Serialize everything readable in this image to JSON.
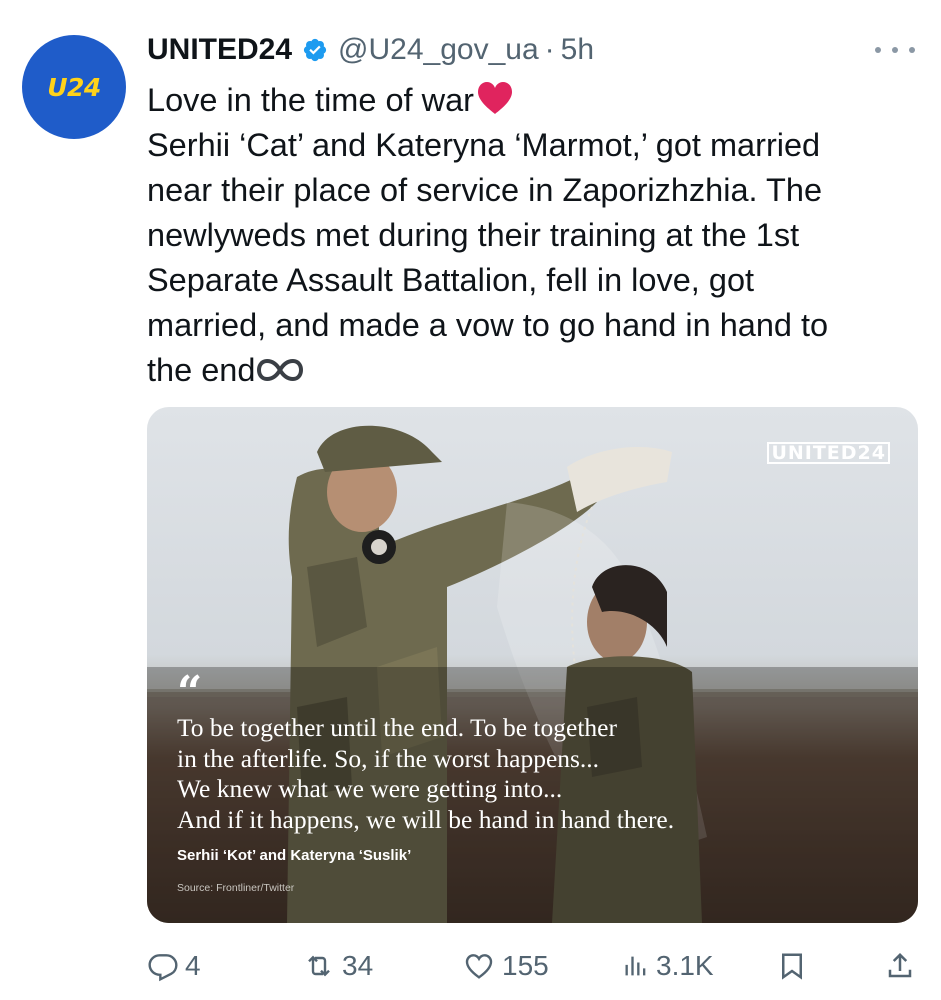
{
  "tweet": {
    "author": {
      "display_name": "UNITED24",
      "handle": "@U24_gov_ua",
      "time": "5h",
      "avatar_text": "U24",
      "verified": true
    },
    "text_lines": [
      "Love in the time of war",
      "Serhii ‘Cat’ and Kateryna ‘Marmot,’ got married",
      "near their place of service in Zaporizhzhia. The",
      "newlyweds met during their training at the 1st",
      "Separate Assault Battalion, fell in love, got",
      "married, and made a vow to go hand in hand to",
      "the end"
    ],
    "emojis": {
      "after_line_1": "red-heart-emoji",
      "after_last_line": "infinity-emoji"
    },
    "media": {
      "brand": "UNITED24",
      "quote_mark": "“",
      "quote_lines": [
        "To be together until the end. To be together",
        "in the afterlife. So, if the worst happens...",
        "We knew what we were getting into...",
        "And if it happens, we will be hand in hand there."
      ],
      "credit": "Serhii ‘Kot’ and Kateryna ‘Suslik’",
      "source": "Source: Frontliner/Twitter"
    },
    "actions": {
      "replies": "4",
      "reposts": "34",
      "likes": "155",
      "views": "3.1K"
    }
  },
  "colors": {
    "text_primary": "#0f1419",
    "text_secondary": "#536471",
    "verified_blue": "#1d9bf0",
    "avatar_blue": "#1f5cc9",
    "avatar_yellow": "#ffd21a",
    "heart_red": "#e0245e"
  }
}
